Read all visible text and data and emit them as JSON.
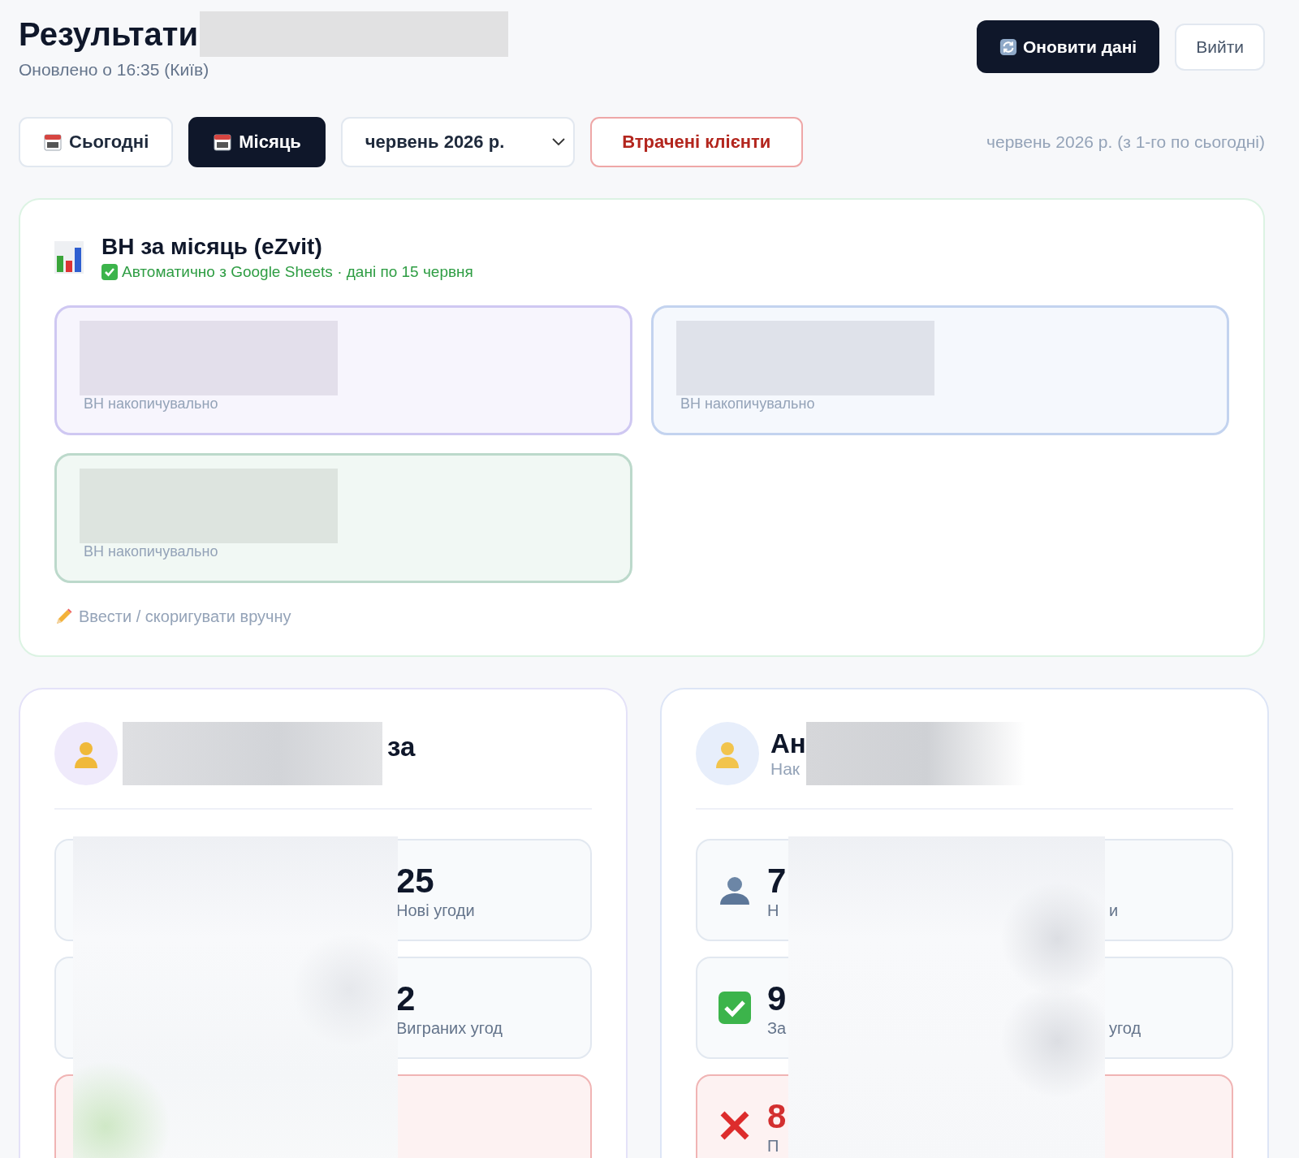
{
  "header": {
    "title": "Результати",
    "updated": "Оновлено о 16:35 (Київ)",
    "buttons": [
      {
        "label": "Оновити дані",
        "kind": "primary"
      },
      {
        "label": "Вийти",
        "kind": "secondary"
      }
    ]
  },
  "filters": {
    "periods": [
      {
        "label": "Сьогодні",
        "selected": false
      },
      {
        "label": "Місяць",
        "selected": true
      }
    ],
    "month_select": {
      "value": "червень 2026 р."
    },
    "lost_clients": "Втрачені клієнти",
    "range": "червень 2026 р. (з 1-го по сьогодні)"
  },
  "revenue_card": {
    "title": "ВН за місяць (eZvit)",
    "source": "Автоматично з Google Sheets · дані по 15 червня",
    "tiles": [
      {
        "label": "ВН накопичувально",
        "color": "#cfc8f2"
      },
      {
        "label": "ВН накопичувально",
        "color": "#c3d3ef"
      },
      {
        "label": "ВН накопичувально",
        "color": "#bcd9cb"
      }
    ],
    "manual_link": "Ввести / скоригувати вручну"
  },
  "managers": [
    {
      "kind": "redacted-start",
      "name": "за",
      "stats": [
        {
          "kind": "new",
          "value": "25",
          "label": "Нові угоди"
        },
        {
          "kind": "won",
          "value": "2",
          "label": "Виграних угод"
        },
        {
          "kind": "lost"
        }
      ]
    },
    {
      "kind": "redacted-middle",
      "name": "Ан",
      "subtitle": "Нак",
      "stats": [
        {
          "kind": "new",
          "value": "7",
          "label": "Н",
          "label_tail": "и"
        },
        {
          "kind": "won",
          "value": "9",
          "label": "За",
          "label_tail": "угод"
        },
        {
          "kind": "lost",
          "value": "8",
          "label": "П"
        }
      ]
    }
  ]
}
